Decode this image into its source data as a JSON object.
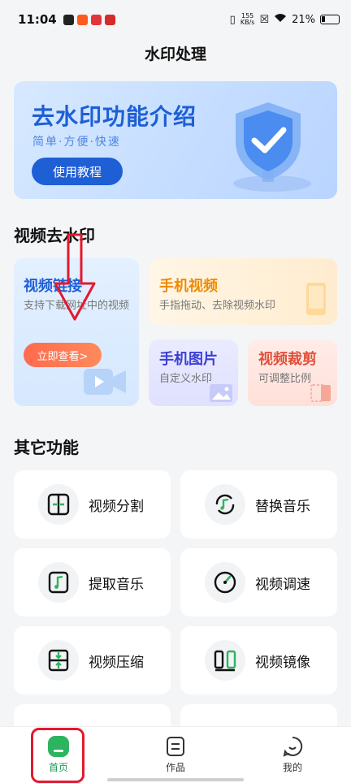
{
  "status": {
    "time": "11:04",
    "net_speed_top": "155",
    "net_speed_bottom": "KB/s",
    "battery": "21%"
  },
  "page": {
    "title": "水印处理"
  },
  "banner": {
    "title": "去水印功能介绍",
    "subtitle": "简单·方便·快速",
    "button": "使用教程",
    "accent": "#1f5fd6"
  },
  "video_section": {
    "title": "视频去水印",
    "link_card": {
      "title": "视频链接",
      "desc": "支持下载网址中的视频",
      "button": "立即查看>"
    },
    "phone_video": {
      "title": "手机视频",
      "desc": "手指拖动、去除视频水印"
    },
    "phone_image": {
      "title": "手机图片",
      "desc": "自定义水印"
    },
    "crop": {
      "title": "视频裁剪",
      "desc": "可调整比例"
    }
  },
  "other_section": {
    "title": "其它功能",
    "tiles": [
      {
        "label": "视频分割",
        "icon": "split-icon"
      },
      {
        "label": "替换音乐",
        "icon": "replace-music-icon"
      },
      {
        "label": "提取音乐",
        "icon": "extract-music-icon"
      },
      {
        "label": "视频调速",
        "icon": "speed-icon"
      },
      {
        "label": "视频压缩",
        "icon": "compress-icon"
      },
      {
        "label": "视频镜像",
        "icon": "mirror-icon"
      }
    ]
  },
  "nav": {
    "items": [
      {
        "label": "首页",
        "icon": "home-icon",
        "active": true
      },
      {
        "label": "作品",
        "icon": "works-icon",
        "active": false
      },
      {
        "label": "我的",
        "icon": "profile-icon",
        "active": false
      }
    ],
    "active_color": "#2db45f",
    "highlight_color": "#e3192f"
  }
}
